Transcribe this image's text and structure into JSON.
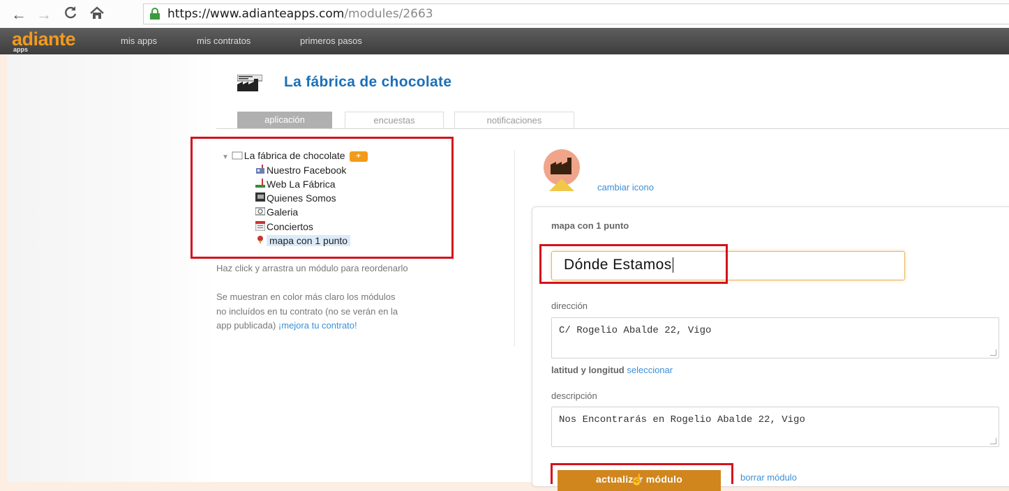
{
  "browser": {
    "url_host": "https://www.adianteapps.com",
    "url_path": "/modules/2663"
  },
  "site_nav": {
    "brand": "adiante",
    "brand_sub": "apps",
    "links": [
      "mis apps",
      "mis contratos",
      "primeros pasos"
    ]
  },
  "app": {
    "title": "La fábrica de chocolate"
  },
  "tabs": [
    "aplicación",
    "encuestas",
    "notificaciones"
  ],
  "tree": {
    "root": "La fábrica de chocolate",
    "add_badge": "+",
    "items": [
      "Nuestro Facebook",
      "Web La Fábrica",
      "Quienes Somos",
      "Galeria",
      "Conciertos",
      "mapa con 1 punto"
    ]
  },
  "help": {
    "reorder": "Haz click y arrastra un módulo para reordenarlo",
    "note_line1": "Se muestran en color más claro los módulos",
    "note_line2": "no incluídos en tu contrato (no se verán en la",
    "note_line3": "app publicada) ",
    "upgrade_link": "¡mejora tu contrato!"
  },
  "module": {
    "change_icon": "cambiar icono",
    "type_label": "mapa con 1 punto",
    "title_value": "Dónde Estamos",
    "address_label": "dirección",
    "address_value": "C/ Rogelio Abalde 22, Vigo",
    "latlon_label": "latitud y longitud",
    "latlon_select": "seleccionar",
    "description_label": "descripción",
    "description_value": "Nos Encontrarás en Rogelio Abalde 22, Vigo",
    "update_button": "actualizar módulo",
    "delete_link": "borrar módulo"
  },
  "colors": {
    "brand_orange": "#f29a1f",
    "link_blue": "#3d8fd6",
    "highlight_red": "#d4121b",
    "update_button": "#d0861d"
  }
}
